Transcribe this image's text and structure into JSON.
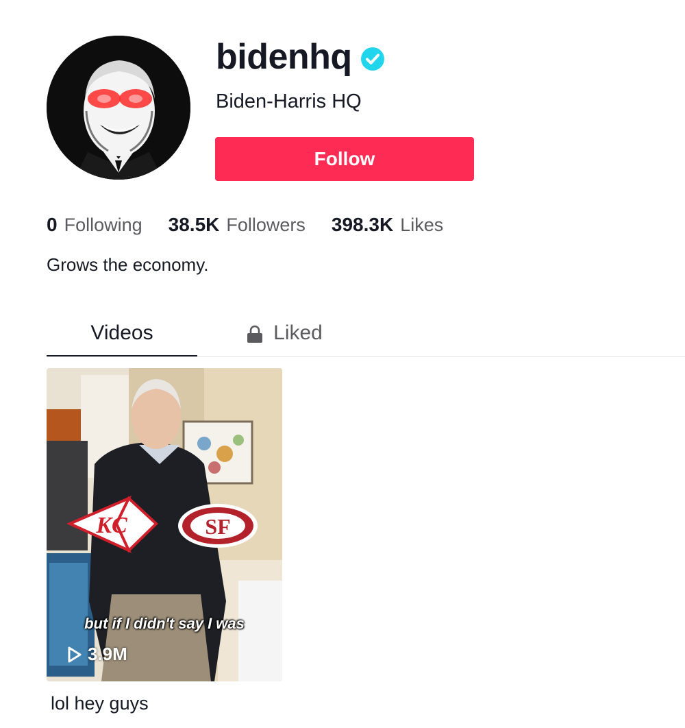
{
  "profile": {
    "username": "bidenhq",
    "display_name": "Biden-Harris HQ",
    "bio": "Grows the economy.",
    "verified": true,
    "avatar_icon": "avatar-laser-eyes-portrait"
  },
  "actions": {
    "follow_label": "Follow",
    "follow_color": "#fe2c55"
  },
  "stats": [
    {
      "value": "0",
      "label": "Following"
    },
    {
      "value": "38.5K",
      "label": "Followers"
    },
    {
      "value": "398.3K",
      "label": "Likes"
    }
  ],
  "tabs": {
    "videos_label": "Videos",
    "liked_label": "Liked",
    "liked_icon": "lock-icon",
    "active": "Videos"
  },
  "videos": [
    {
      "overlay_caption": "but if I didn't say I was",
      "views": "3.9M",
      "title": "lol hey guys",
      "badge_left": "KC",
      "badge_right": "SF"
    }
  ],
  "colors": {
    "verified": "#20d5ec",
    "text_primary": "#161823",
    "text_secondary": "#5b5b5f"
  }
}
